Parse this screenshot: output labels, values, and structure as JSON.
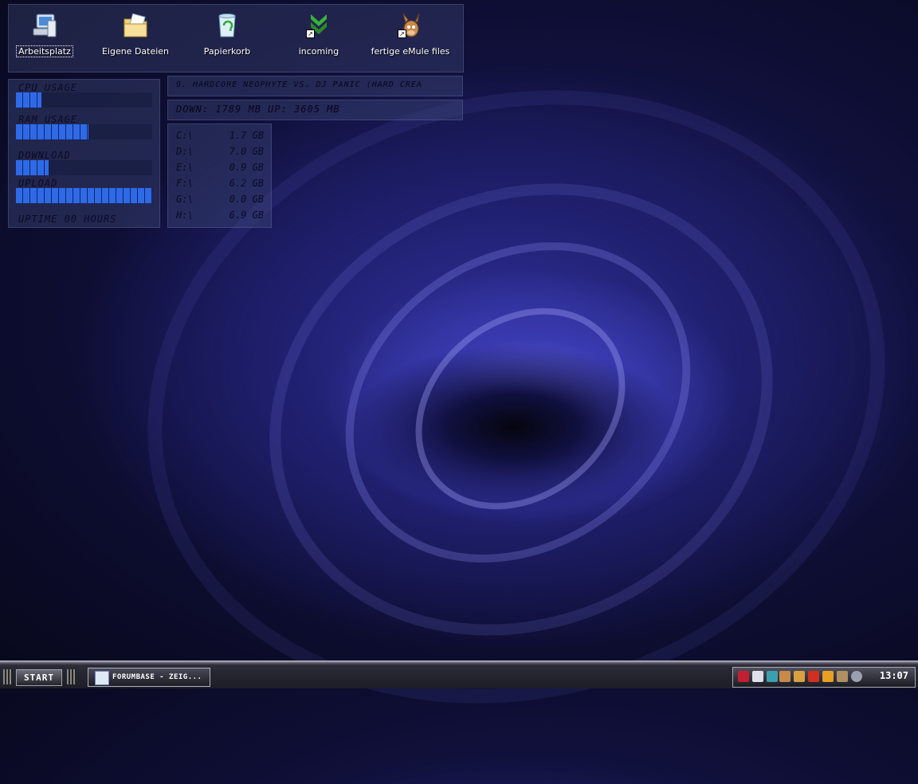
{
  "desktop_icons": [
    {
      "label": "Arbeitsplatz",
      "icon": "my-computer-icon",
      "selected": true
    },
    {
      "label": "Eigene Dateien",
      "icon": "my-documents-folder-icon"
    },
    {
      "label": "Papierkorb",
      "icon": "recycle-bin-icon"
    },
    {
      "label": "incoming",
      "icon": "download-arrow-icon",
      "shortcut": true
    },
    {
      "label": "fertige eMule files",
      "icon": "emule-mule-icon",
      "shortcut": true
    }
  ],
  "system_monitor": {
    "cpu_label": "CPU USAGE",
    "ram_label": "RAM USAGE",
    "download_label": "DOWNLOAD",
    "upload_label": "UPLOAD",
    "uptime": "UPTIME 00 HOURS",
    "cpu_level": 0.19,
    "ram_level": 0.53,
    "download_level": 0.24,
    "upload_level": 1.0
  },
  "now_playing": "9. HARDCORE NEOPHYTE VS. DJ PANIC (HARD CREA",
  "traffic": "DOWN: 1789 MB UP: 3605 MB",
  "drives": [
    {
      "drive": "C:\\",
      "free": "1.7 GB"
    },
    {
      "drive": "D:\\",
      "free": "7.0 GB"
    },
    {
      "drive": "E:\\",
      "free": "0.9 GB"
    },
    {
      "drive": "F:\\",
      "free": "6.2 GB"
    },
    {
      "drive": "G:\\",
      "free": "0.0 GB"
    },
    {
      "drive": "H:\\",
      "free": "6.9 GB"
    }
  ],
  "taskbar": {
    "start_label": "START",
    "task_label": "FORUMBASE - ZEIG...",
    "clock": "13:07"
  },
  "colors": {
    "meter_fill": "#2e6ae8",
    "wallpaper_core": "#6a6ae8"
  }
}
